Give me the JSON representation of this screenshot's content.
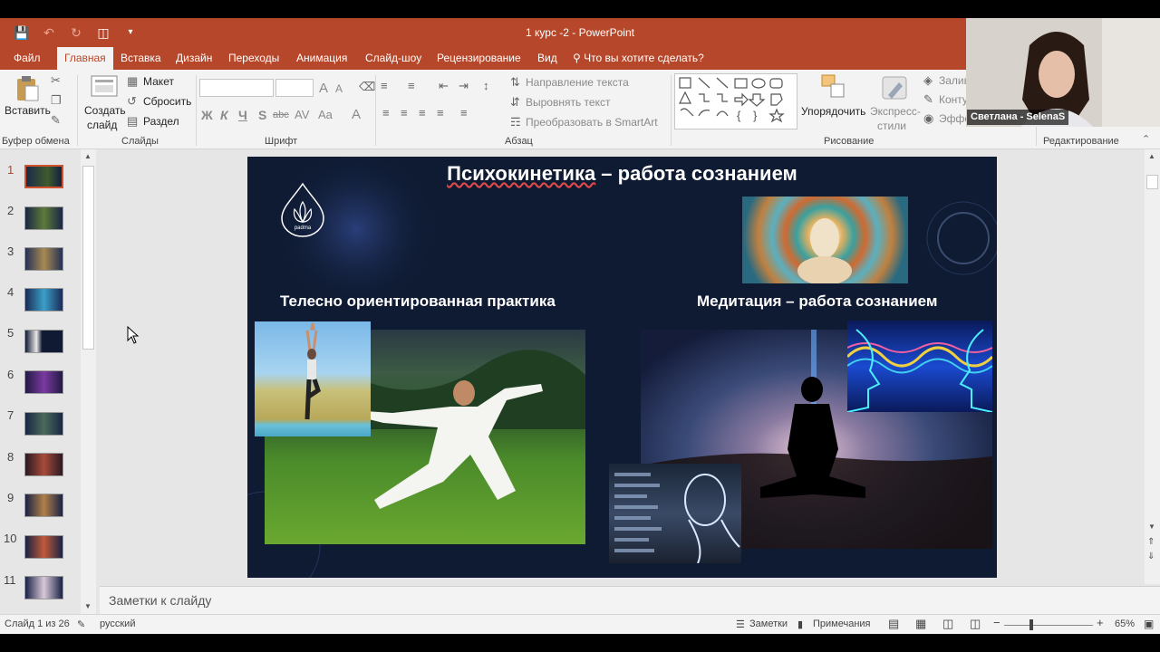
{
  "window": {
    "title": "1 курс -2 - PowerPoint"
  },
  "quick_access": {
    "icons": [
      "save-icon",
      "undo-icon",
      "redo-icon",
      "start-from-beginning-icon",
      "customize-icon"
    ]
  },
  "tabs": [
    "Файл",
    "Главная",
    "Вставка",
    "Дизайн",
    "Переходы",
    "Анимация",
    "Слайд-шоу",
    "Рецензирование",
    "Вид"
  ],
  "tell_me": "Что вы хотите сделать?",
  "ribbon": {
    "clipboard": {
      "paste": "Вставить",
      "label": "Буфер обмена"
    },
    "slides": {
      "new_slide_1": "Создать",
      "new_slide_2": "слайд",
      "layout": "Макет",
      "reset": "Сбросить",
      "section": "Раздел",
      "label": "Слайды"
    },
    "font": {
      "bold": "Ж",
      "italic": "К",
      "underline": "Ч",
      "shadow": "S",
      "strike": "abc",
      "spacing": "AV",
      "case": "Aa",
      "color": "A",
      "grow": "A",
      "shrink": "A",
      "label": "Шрифт"
    },
    "paragraph": {
      "text_direction": "Направление текста",
      "align_text": "Выровнять текст",
      "smartart": "Преобразовать в SmartArt",
      "label": "Абзац"
    },
    "drawing": {
      "arrange": "Упорядочить",
      "quick_styles_1": "Экспресс-",
      "quick_styles_2": "стили",
      "fill": "Залив",
      "outline": "Конту",
      "effects": "Эффе",
      "label": "Рисование"
    },
    "editing": {
      "label": "Редактирование"
    }
  },
  "thumbnails": [
    {
      "num": "1",
      "selected": true
    },
    {
      "num": "2",
      "selected": false
    },
    {
      "num": "3",
      "selected": false
    },
    {
      "num": "4",
      "selected": false
    },
    {
      "num": "5",
      "selected": false
    },
    {
      "num": "6",
      "selected": false
    },
    {
      "num": "7",
      "selected": false
    },
    {
      "num": "8",
      "selected": false
    },
    {
      "num": "9",
      "selected": false
    },
    {
      "num": "10",
      "selected": false
    },
    {
      "num": "11",
      "selected": false
    }
  ],
  "slide": {
    "title_part1": "Психокинетика",
    "title_part2": " – работа сознанием",
    "logo_text": "padma",
    "left_heading": "Телесно ориентированная практика",
    "right_heading": "Медитация – работа сознанием"
  },
  "notes": {
    "placeholder": "Заметки к слайду"
  },
  "status": {
    "slide_of": "Слайд 1 из 26",
    "language": "русский",
    "notes_btn": "Заметки",
    "comments_btn": "Примечания",
    "zoom": "65%"
  },
  "webcam": {
    "name": "Светлана - SelenaS"
  },
  "colors": {
    "accent": "#b7472a",
    "slide_bg": "#0f1b33"
  }
}
